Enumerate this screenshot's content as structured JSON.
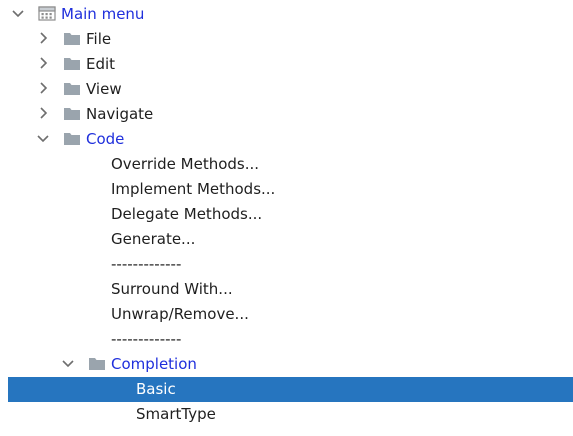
{
  "tree": {
    "root": {
      "label": "Main menu"
    },
    "groups": [
      {
        "label": "File"
      },
      {
        "label": "Edit"
      },
      {
        "label": "View"
      },
      {
        "label": "Navigate"
      },
      {
        "label": "Code"
      }
    ],
    "code_items": [
      "Override Methods...",
      "Implement Methods...",
      "Delegate Methods...",
      "Generate...",
      "-------------",
      "Surround With...",
      "Unwrap/Remove...",
      "-------------"
    ],
    "completion": {
      "label": "Completion"
    },
    "completion_items": [
      "Basic",
      "SmartType"
    ]
  },
  "selected_item": "Basic",
  "colors": {
    "selection_bg": "#2675bf",
    "link_text": "#1f2fdc",
    "text": "#1f1f1f",
    "folder": "#9aa4ad"
  }
}
